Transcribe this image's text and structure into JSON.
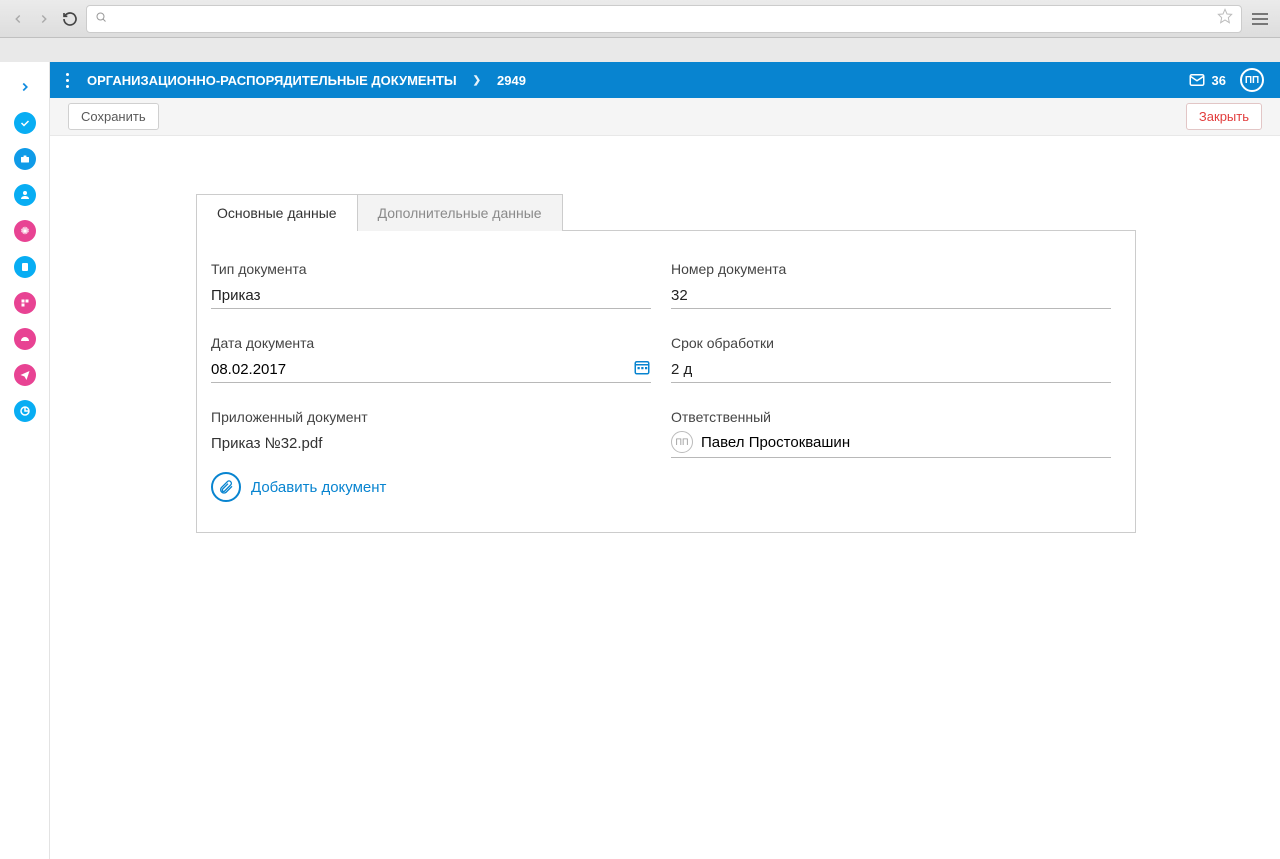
{
  "browser": {
    "url": "",
    "placeholder": ""
  },
  "header": {
    "breadcrumb_root": "ОРГАНИЗАЦИОННО-РАСПОРЯДИТЕЛЬНЫЕ ДОКУМЕНТЫ",
    "breadcrumb_id": "2949",
    "mail_count": "36",
    "avatar_initials": "ПП"
  },
  "actions": {
    "save": "Сохранить",
    "close": "Закрыть"
  },
  "tabs": {
    "main": "Основные данные",
    "extra": "Дополнительные данные"
  },
  "form": {
    "doc_type_label": "Тип документа",
    "doc_type_value": "Приказ",
    "doc_number_label": "Номер документа",
    "doc_number_value": "32",
    "doc_date_label": "Дата документа",
    "doc_date_value": "08.02.2017",
    "deadline_label": "Срок обработки",
    "deadline_value": "2 д",
    "attachment_label": "Приложенный документ",
    "attachment_file": "Приказ №32.pdf",
    "add_doc_label": "Добавить документ",
    "responsible_label": "Ответственный",
    "responsible_value": "Павел Простоквашин",
    "responsible_initials": "ПП"
  }
}
